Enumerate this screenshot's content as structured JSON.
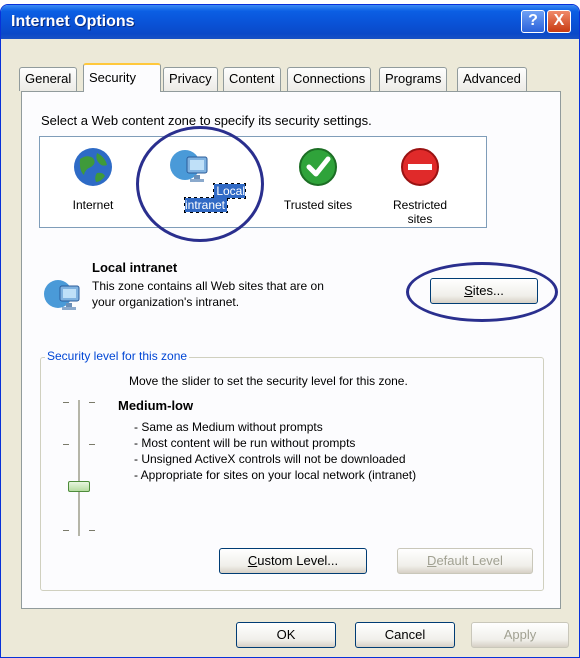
{
  "window": {
    "title": "Internet Options"
  },
  "titlebar_buttons": {
    "help": "?",
    "close": "X"
  },
  "tabs": [
    "General",
    "Security",
    "Privacy",
    "Content",
    "Connections",
    "Programs",
    "Advanced"
  ],
  "active_tab": "Security",
  "zones_prompt": "Select a Web content zone to specify its security settings.",
  "zones": [
    {
      "label": "Internet",
      "icon": "globe-icon"
    },
    {
      "label": "Local intranet",
      "icon": "intranet-monitor-icon",
      "selected": true
    },
    {
      "label": "Trusted sites",
      "icon": "checkmark-icon"
    },
    {
      "label": "Restricted sites",
      "label_line1": "Restricted",
      "label_line2": "sites",
      "icon": "restricted-icon"
    }
  ],
  "selected_zone": {
    "title": "Local intranet",
    "description": "This zone contains all Web sites that are on your organization's intranet.",
    "sites_button": "Sites...",
    "sites_button_key": "S",
    "sites_button_rest": "ites..."
  },
  "security_level": {
    "legend": "Security level for this zone",
    "slider_hint": "Move the slider to set the security level for this zone.",
    "level": "Medium-low",
    "items": [
      "- Same as Medium without prompts",
      "- Most content will be run without prompts",
      "- Unsigned ActiveX controls will not be downloaded",
      "- Appropriate for sites on your local network (intranet)"
    ],
    "custom_level_button": "Custom Level...",
    "custom_key": "C",
    "custom_rest": "ustom Level...",
    "default_level_button": "Default Level",
    "default_key": "D",
    "default_rest": "efault Level"
  },
  "footer": {
    "ok": "OK",
    "cancel": "Cancel",
    "apply": "Apply"
  },
  "colors": {
    "titlebar": "#0a52d6",
    "annotation_circle": "#2a2f8e",
    "selection": "#316ac5"
  }
}
